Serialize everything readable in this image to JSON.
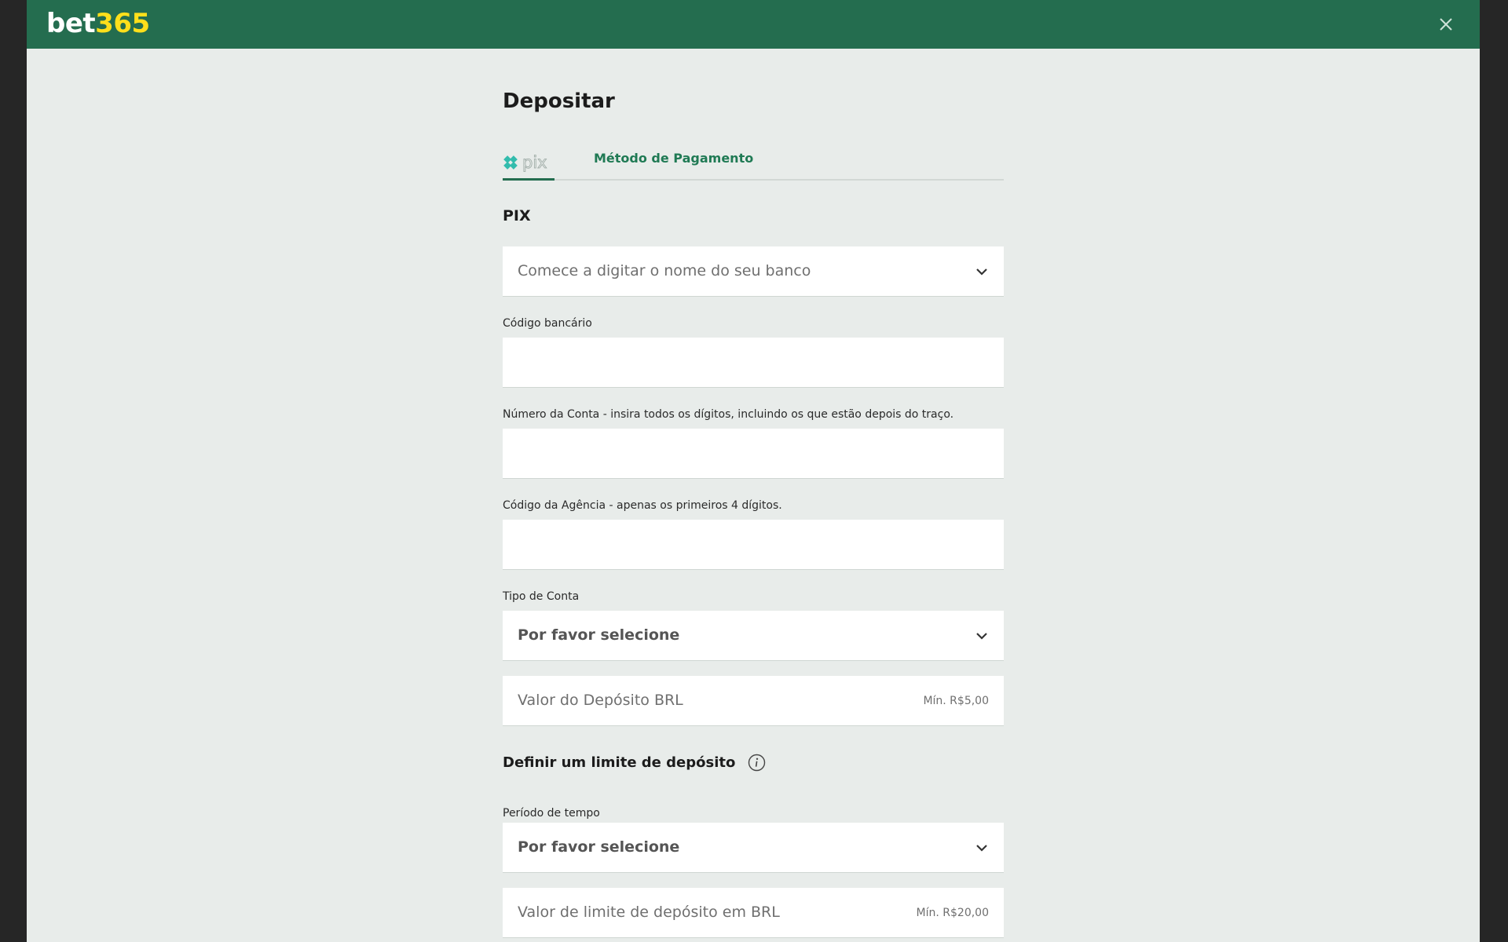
{
  "brand": {
    "logo_white": "bet",
    "logo_yellow": "365"
  },
  "page": {
    "title": "Depositar"
  },
  "tabs": {
    "pix_logo_text": "pix",
    "method_label": "Método de Pagamento"
  },
  "pix": {
    "section_title": "PIX",
    "bank_select_placeholder": "Comece a digitar o nome do seu banco",
    "bank_code_label": "Código bancário",
    "account_number_label": "Número da Conta - insira todos os dígitos, incluindo os que estão depois do traço.",
    "agency_code_label": "Código da Agência - apenas os primeiros 4 dígitos.",
    "account_type_label": "Tipo de Conta",
    "account_type_value": "Por favor selecione",
    "deposit_amount_placeholder": "Valor do Depósito BRL",
    "deposit_amount_min": "Mín. R$5,00"
  },
  "limit": {
    "heading": "Definir um limite de depósito",
    "period_label": "Período de tempo",
    "period_value": "Por favor selecione",
    "limit_amount_placeholder": "Valor de limite de depósito em BRL",
    "limit_amount_min": "Mín. R$20,00"
  },
  "colors": {
    "header_green": "#246d4f",
    "logo_yellow": "#ffdf1b",
    "page_background": "#e8ecea",
    "accent_green": "#1f7a54",
    "pix_teal": "#32bcad"
  },
  "icons": {
    "close": "close-icon",
    "chevron": "chevron-down-icon",
    "info": "info-icon",
    "pix": "pix-logo-icon"
  }
}
